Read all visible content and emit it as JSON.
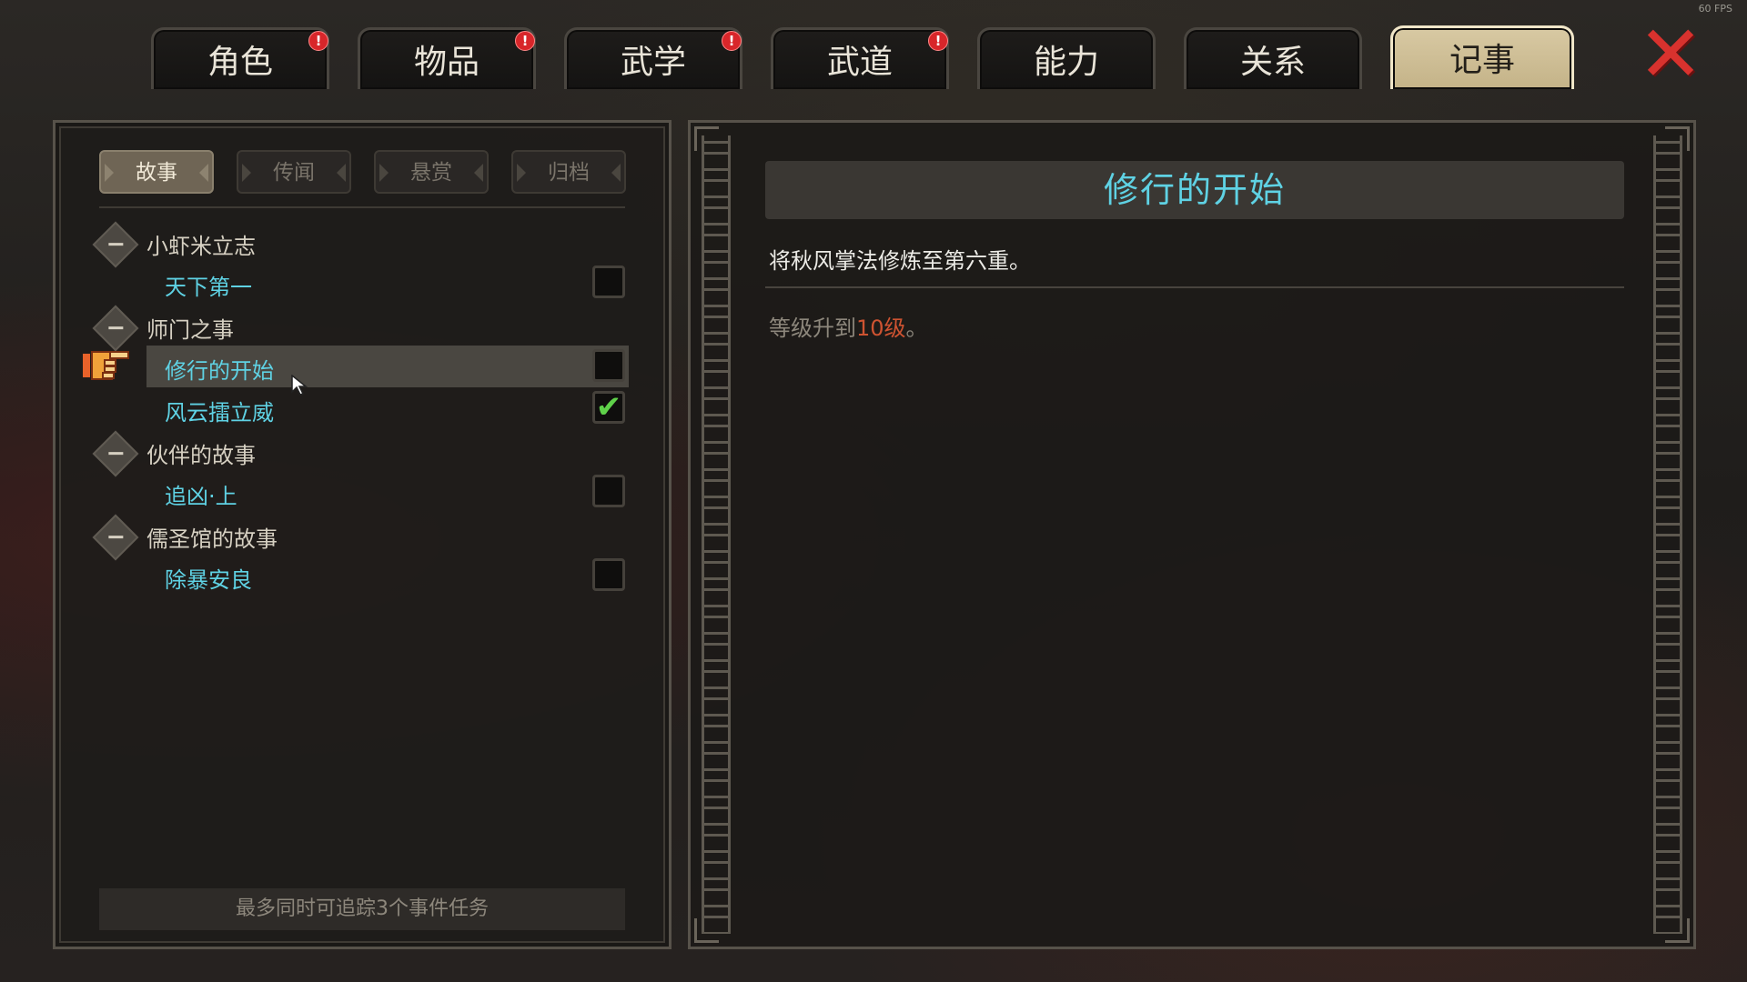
{
  "fps": "60 FPS",
  "top_tabs": [
    {
      "label": "角色",
      "badge": "!"
    },
    {
      "label": "物品",
      "badge": "!"
    },
    {
      "label": "武学",
      "badge": "!"
    },
    {
      "label": "武道",
      "badge": "!"
    },
    {
      "label": "能力",
      "badge": ""
    },
    {
      "label": "关系",
      "badge": ""
    },
    {
      "label": "记事",
      "badge": "",
      "active": true
    }
  ],
  "close_icon": "✕",
  "left_panel": {
    "sub_tabs": [
      {
        "label": "故事",
        "active": true
      },
      {
        "label": "传闻"
      },
      {
        "label": "悬赏"
      },
      {
        "label": "归档"
      }
    ],
    "groups": [
      {
        "label": "小虾米立志",
        "quests": [
          {
            "label": "天下第一",
            "checked": false
          }
        ]
      },
      {
        "label": "师门之事",
        "quests": [
          {
            "label": "修行的开始",
            "checked": false,
            "selected": true
          },
          {
            "label": "风云擂立威",
            "checked": true
          }
        ]
      },
      {
        "label": "伙伴的故事",
        "quests": [
          {
            "label": "追凶·上",
            "checked": false
          }
        ]
      },
      {
        "label": "儒圣馆的故事",
        "quests": [
          {
            "label": "除暴安良",
            "checked": false
          }
        ]
      }
    ],
    "check_mark": "✔",
    "footer_note": "最多同时可追踪3个事件任务"
  },
  "detail": {
    "title": "修行的开始",
    "description": "将秋风掌法修炼至第六重。",
    "requirement_prefix": "等级升到",
    "requirement_value": "10级",
    "requirement_suffix": "。"
  }
}
